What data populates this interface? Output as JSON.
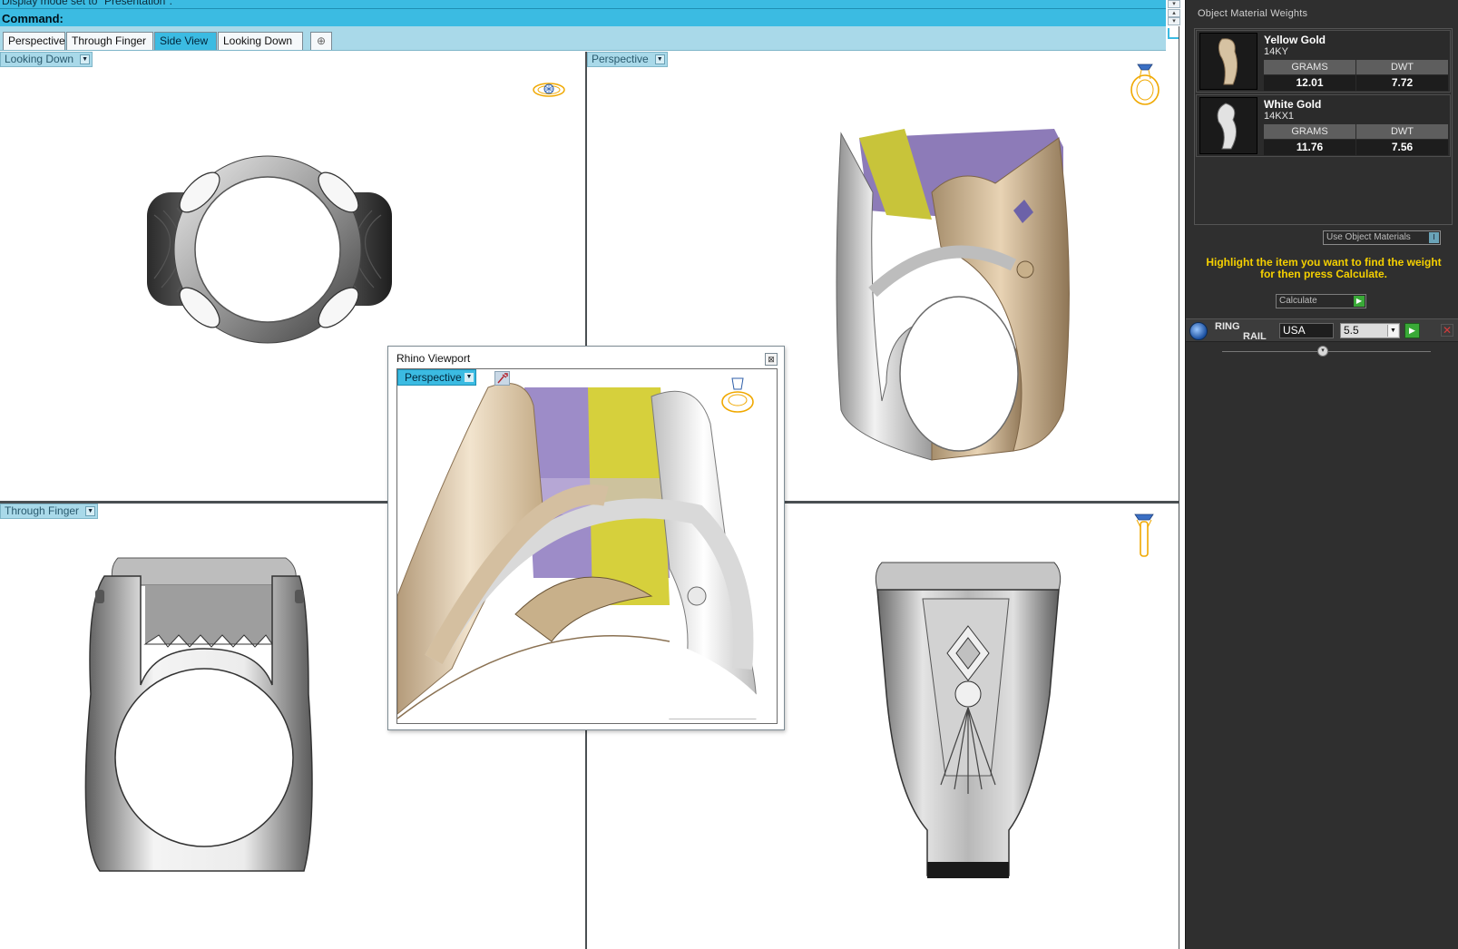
{
  "command": {
    "history_text": "Display mode set to \"Presentation\".",
    "prompt": "Command:"
  },
  "tabs": [
    {
      "label": "Perspective",
      "active": false
    },
    {
      "label": "Through Finger",
      "active": false
    },
    {
      "label": "Side View",
      "active": true
    },
    {
      "label": "Looking Down",
      "active": false
    }
  ],
  "viewports": {
    "top_left": {
      "label": "Looking Down"
    },
    "top_right": {
      "label": "Perspective"
    },
    "bottom_left": {
      "label": "Through Finger"
    },
    "bottom_right": {
      "label": ""
    }
  },
  "floating_viewport": {
    "title": "Rhino Viewport",
    "label": "Perspective"
  },
  "panel": {
    "title": "Object Material Weights",
    "materials": [
      {
        "name": "Yellow Gold",
        "code": "14KY",
        "grams_header": "GRAMS",
        "dwt_header": "DWT",
        "grams": "12.01",
        "dwt": "7.72"
      },
      {
        "name": "White Gold",
        "code": "14KX1",
        "grams_header": "GRAMS",
        "dwt_header": "DWT",
        "grams": "11.76",
        "dwt": "7.56"
      }
    ],
    "use_object_materials": "Use Object Materials",
    "hint": "Highlight the item you want to find the weight for then press Calculate.",
    "calculate_label": "Calculate",
    "ring_rail": {
      "title_1": "RING",
      "title_2": "RAIL",
      "country": "USA",
      "size": "5.5"
    }
  },
  "colors": {
    "accent": "#3bbbe2",
    "tab_bar": "#a9d9e9",
    "panel_bg": "#2f2f2f",
    "hint_text": "#f5d000",
    "yellow_gold": "#d8c0a0",
    "white_gold": "#d9d9d9",
    "gem_purple": "#8e7bbf",
    "gem_yellow": "#c9c329"
  }
}
